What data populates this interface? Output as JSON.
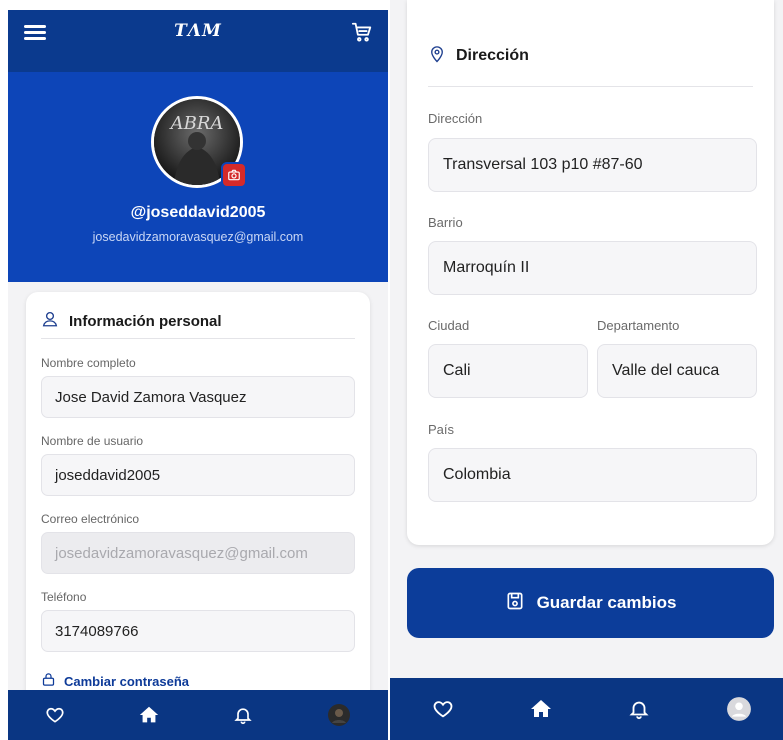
{
  "app": {
    "logo": "TΛM"
  },
  "profile": {
    "handle": "@joseddavid2005",
    "email": "josedavidzamoravasquez@gmail.com"
  },
  "personal": {
    "title": "Información personal",
    "fields": [
      {
        "label": "Nombre completo",
        "value": "Jose David Zamora Vasquez"
      },
      {
        "label": "Nombre de usuario",
        "value": "joseddavid2005"
      },
      {
        "label": "Correo electrónico",
        "value": "josedavidzamoravasquez@gmail.com"
      },
      {
        "label": "Teléfono",
        "value": "3174089766"
      }
    ],
    "change_password": "Cambiar contraseña"
  },
  "address": {
    "title": "Dirección",
    "direccion_label": "Dirección",
    "direccion_value": "Transversal 103 p10 #87-60",
    "barrio_label": "Barrio",
    "barrio_value": "Marroquín II",
    "ciudad_label": "Ciudad",
    "ciudad_value": "Cali",
    "departamento_label": "Departamento",
    "departamento_value": "Valle del cauca",
    "pais_label": "País",
    "pais_value": "Colombia"
  },
  "save_button": "Guardar cambios",
  "icons": {
    "menu": "hamburger-icon",
    "cart": "cart-icon",
    "camera": "camera-icon",
    "user": "user-icon",
    "location": "location-pin-icon",
    "lock": "lock-icon",
    "save": "floppy-disk-icon",
    "nav": [
      "heart-icon",
      "home-icon",
      "bell-icon",
      "avatar-icon"
    ]
  },
  "colors": {
    "header": "#0b3a8e",
    "hero": "#0d45b8",
    "nav": "#0a3683",
    "button": "#0c3d9a",
    "accent_red": "#d42a2a",
    "link": "#0d3a98"
  }
}
